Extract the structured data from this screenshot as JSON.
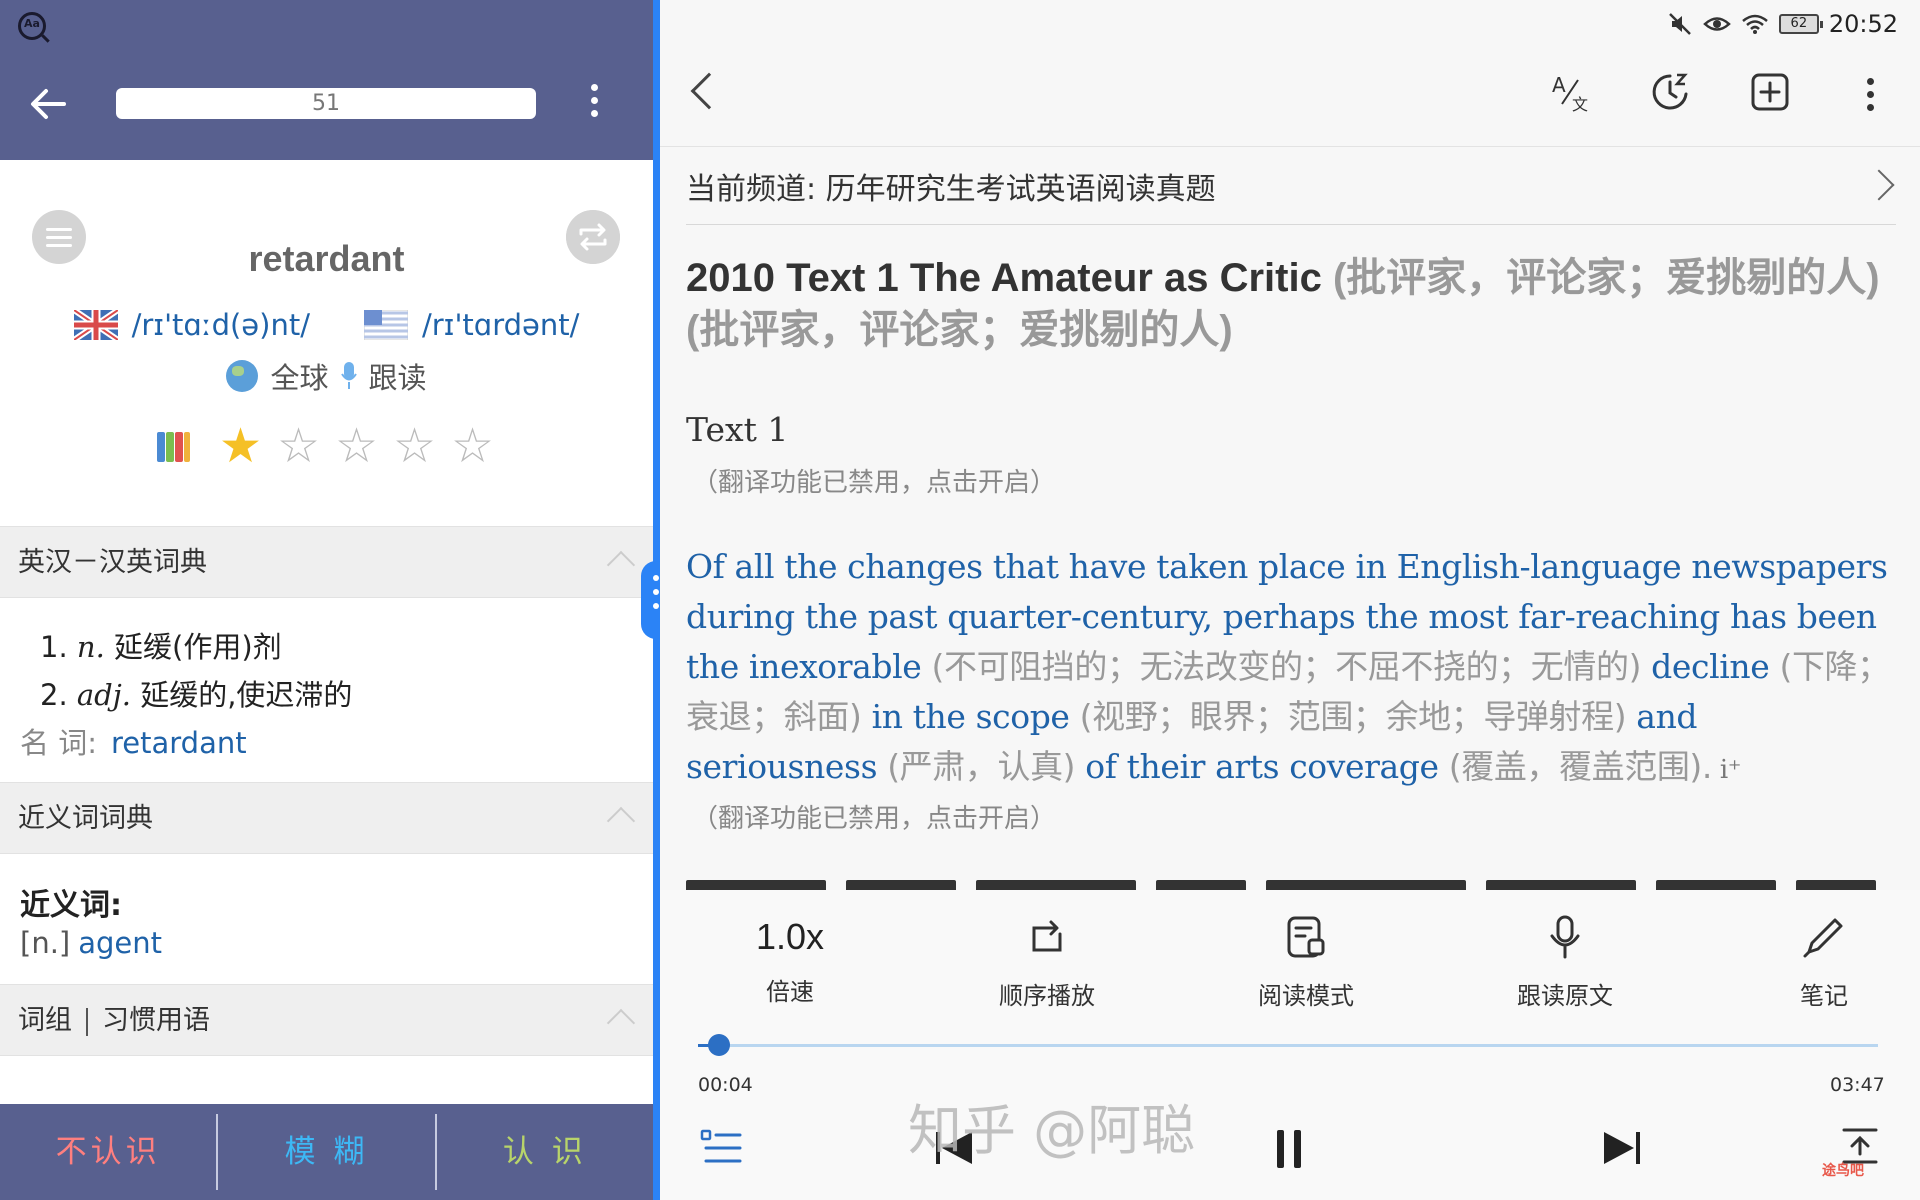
{
  "dictionary": {
    "header": {
      "page_number": "51"
    },
    "word": "retardant",
    "phonetics": {
      "uk": "/rɪ'tɑːd(ə)nt/",
      "us": "/rɪ'tɑrdənt/"
    },
    "actions": {
      "global": "全球",
      "follow_read": "跟读"
    },
    "rating": {
      "filled": 1,
      "total": 5
    },
    "sections": {
      "en_cn": {
        "title": "英汉－汉英词典",
        "defs": [
          {
            "num": "1.",
            "pos": "n.",
            "text": "延缓(作用)剂"
          },
          {
            "num": "2.",
            "pos": "adj.",
            "text": "延缓的,使迟滞的"
          }
        ],
        "noun_label": "名 词:",
        "noun_value": "retardant"
      },
      "synonyms": {
        "title": "近义词词典",
        "heading": "近义词:",
        "pos": "[n.]",
        "word": "agent"
      },
      "phrases": {
        "title_a": "词组",
        "title_b": "习惯用语"
      }
    },
    "footer": {
      "unknown": "不认识",
      "fuzzy": "模 糊",
      "known": "认 识",
      "colors": {
        "unknown": "#ff7f7f",
        "fuzzy": "#3db8f5",
        "known": "#b8d46a"
      }
    }
  },
  "reader": {
    "status": {
      "battery": "62",
      "time": "20:52"
    },
    "channel": "当前频道: 历年研究生考试英语阅读真题",
    "title_main": "2010 Text 1 The Amateur as Critic",
    "title_gloss": " (批评家，评论家；爱挑剔的人) (批评家，评论家；爱挑剔的人)",
    "section_label": "Text 1",
    "translation_disabled": "（翻译功能已禁用，点击开启）",
    "para": [
      {
        "t": "Of all the changes that have taken place in English-language newspapers during the past quarter-century, perhaps the most far-reaching has been the inexorable",
        "g": false
      },
      {
        "t": " (不可阻挡的；无法改变的；不屈不挠的；无情的) ",
        "g": true
      },
      {
        "t": "decline",
        "g": false
      },
      {
        "t": " (下降；衰退；斜面) ",
        "g": true
      },
      {
        "t": "in the scope",
        "g": false
      },
      {
        "t": " (视野；眼界；范围；余地；导弹射程) ",
        "g": true
      },
      {
        "t": "and seriousness",
        "g": false
      },
      {
        "t": " (严肃，认真) ",
        "g": true
      },
      {
        "t": "of their arts coverage",
        "g": false
      },
      {
        "t": " (覆盖，覆盖范围).",
        "g": true
      }
    ],
    "info_mark": "i⁺",
    "player": {
      "speed": "1.0x",
      "speed_label": "倍速",
      "order_label": "顺序播放",
      "mode_label": "阅读模式",
      "follow_label": "跟读原文",
      "notes_label": "笔记",
      "elapsed": "00:04",
      "total": "03:47",
      "progress": 0.018
    },
    "watermark": "知乎 @阿聪",
    "site_logo": "途鸟吧"
  },
  "colors": {
    "header": "#58608f",
    "accent": "#2b83f6",
    "link": "#1f62a8",
    "gloss": "#999999"
  }
}
